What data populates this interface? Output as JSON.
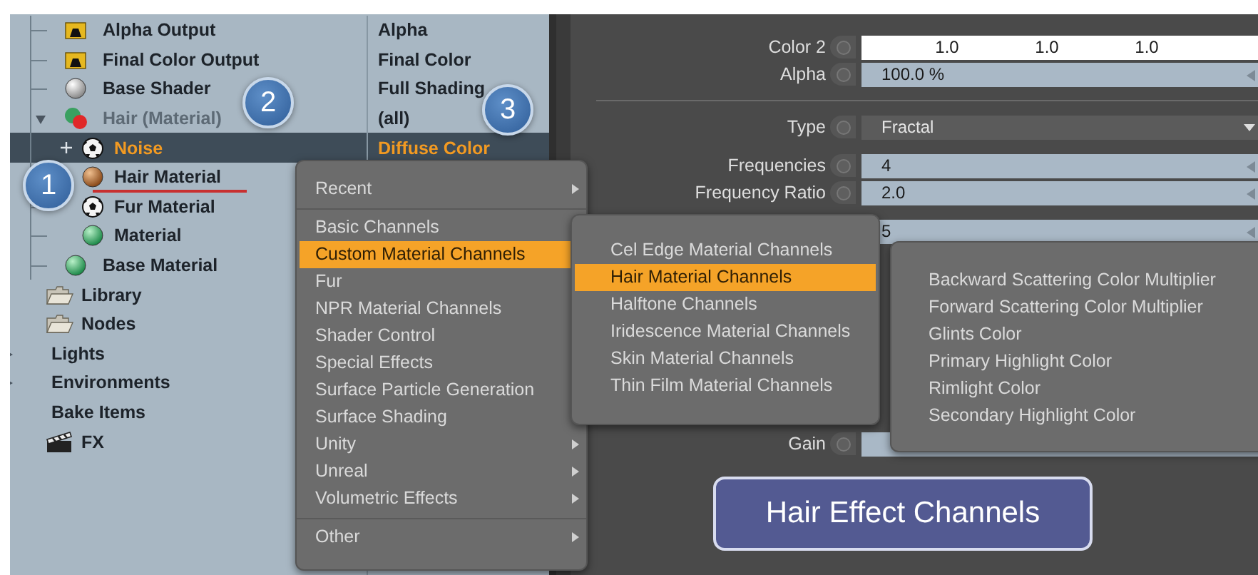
{
  "tree": {
    "shader_nodes": [
      {
        "label": "Alpha Output",
        "value": "Alpha",
        "kind": "output",
        "selected": false,
        "disabled": false
      },
      {
        "label": "Final Color Output",
        "value": "Final Color",
        "kind": "output",
        "selected": false,
        "disabled": false
      },
      {
        "label": "Base Shader",
        "value": "Full Shading",
        "kind": "shader",
        "selected": false,
        "disabled": false
      },
      {
        "label": "Hair (Material)",
        "value": "(all)",
        "kind": "mix",
        "selected": false,
        "disabled": true,
        "expanded": true,
        "children": [
          {
            "label": "Noise",
            "value": "Diffuse Color",
            "kind": "noise",
            "selected": true,
            "expanded": false,
            "underlined": false
          },
          {
            "label": "Hair Material",
            "kind": "hair",
            "selected": false,
            "underlined": true
          },
          {
            "label": "Fur Material",
            "kind": "noise",
            "selected": false,
            "underlined": false
          },
          {
            "label": "Material",
            "kind": "material",
            "selected": false,
            "underlined": false
          }
        ]
      },
      {
        "label": "Base Material",
        "kind": "material",
        "selected": false,
        "disabled": false
      }
    ],
    "scene_items": [
      {
        "label": "Library",
        "kind": "folder",
        "selected": false
      },
      {
        "label": "Nodes",
        "kind": "folder",
        "selected": false
      },
      {
        "label": "Lights",
        "kind": "plain",
        "selected": false,
        "expanded": false
      },
      {
        "label": "Environments",
        "kind": "plain",
        "selected": false,
        "expanded": false
      },
      {
        "label": "Bake Items",
        "kind": "plain",
        "selected": false
      },
      {
        "label": "FX",
        "kind": "fx",
        "selected": false
      }
    ]
  },
  "properties": [
    {
      "kind": "color",
      "label": "Color 2",
      "values": [
        "1.0",
        "1.0",
        "1.0"
      ]
    },
    {
      "kind": "number",
      "label": "Alpha",
      "value": "100.0 %"
    },
    {
      "kind": "separator"
    },
    {
      "kind": "dropdown",
      "label": "Type",
      "value": "Fractal"
    },
    {
      "kind": "number",
      "label": "Frequencies",
      "value": "4"
    },
    {
      "kind": "number",
      "label": "Frequency Ratio",
      "value": "2.0"
    },
    {
      "kind": "number",
      "value": "5"
    },
    {
      "kind": "number",
      "label": "Gain"
    }
  ],
  "button": {
    "label": "Hair Effect Channels"
  },
  "menus": [
    {
      "groups": [
        [
          {
            "label": "Recent",
            "submenu": true,
            "selected": false
          }
        ],
        [
          {
            "label": "Basic Channels",
            "selected": false
          },
          {
            "label": "Custom Material Channels",
            "selected": true
          },
          {
            "label": "Fur",
            "selected": false
          },
          {
            "label": "NPR Material Channels",
            "selected": false
          },
          {
            "label": "Shader Control",
            "selected": false
          },
          {
            "label": "Special Effects",
            "selected": false
          },
          {
            "label": "Surface Particle Generation",
            "selected": false
          },
          {
            "label": "Surface Shading",
            "selected": false
          },
          {
            "label": "Unity",
            "submenu": true,
            "selected": false
          },
          {
            "label": "Unreal",
            "submenu": true,
            "selected": false
          },
          {
            "label": "Volumetric Effects",
            "submenu": true,
            "selected": false
          }
        ],
        [
          {
            "label": "Other",
            "submenu": true,
            "selected": false
          }
        ]
      ]
    },
    {
      "groups": [
        [
          {
            "label": "Cel Edge Material Channels",
            "submenu": false,
            "selected": false
          },
          {
            "label": "Hair Material Channels",
            "submenu": false,
            "selected": true
          },
          {
            "label": "Halftone Channels",
            "submenu": false,
            "selected": false
          },
          {
            "label": "Iridescence Material Channels",
            "submenu": false,
            "selected": false
          },
          {
            "label": "Skin Material Channels",
            "submenu": false,
            "selected": false
          },
          {
            "label": "Thin Film Material Channels",
            "submenu": false,
            "selected": false
          }
        ]
      ]
    },
    {
      "groups": [
        [
          {
            "label": "Backward Scattering Color Multiplier",
            "selected": false
          },
          {
            "label": "Forward Scattering Color Multiplier",
            "selected": false
          },
          {
            "label": "Glints Color",
            "selected": false
          },
          {
            "label": "Primary Highlight Color",
            "selected": false
          },
          {
            "label": "Rimlight Color",
            "selected": false
          },
          {
            "label": "Secondary Highlight Color",
            "selected": false
          }
        ]
      ]
    }
  ],
  "annotations": [
    {
      "label": "1"
    },
    {
      "label": "2"
    },
    {
      "label": "3"
    }
  ]
}
